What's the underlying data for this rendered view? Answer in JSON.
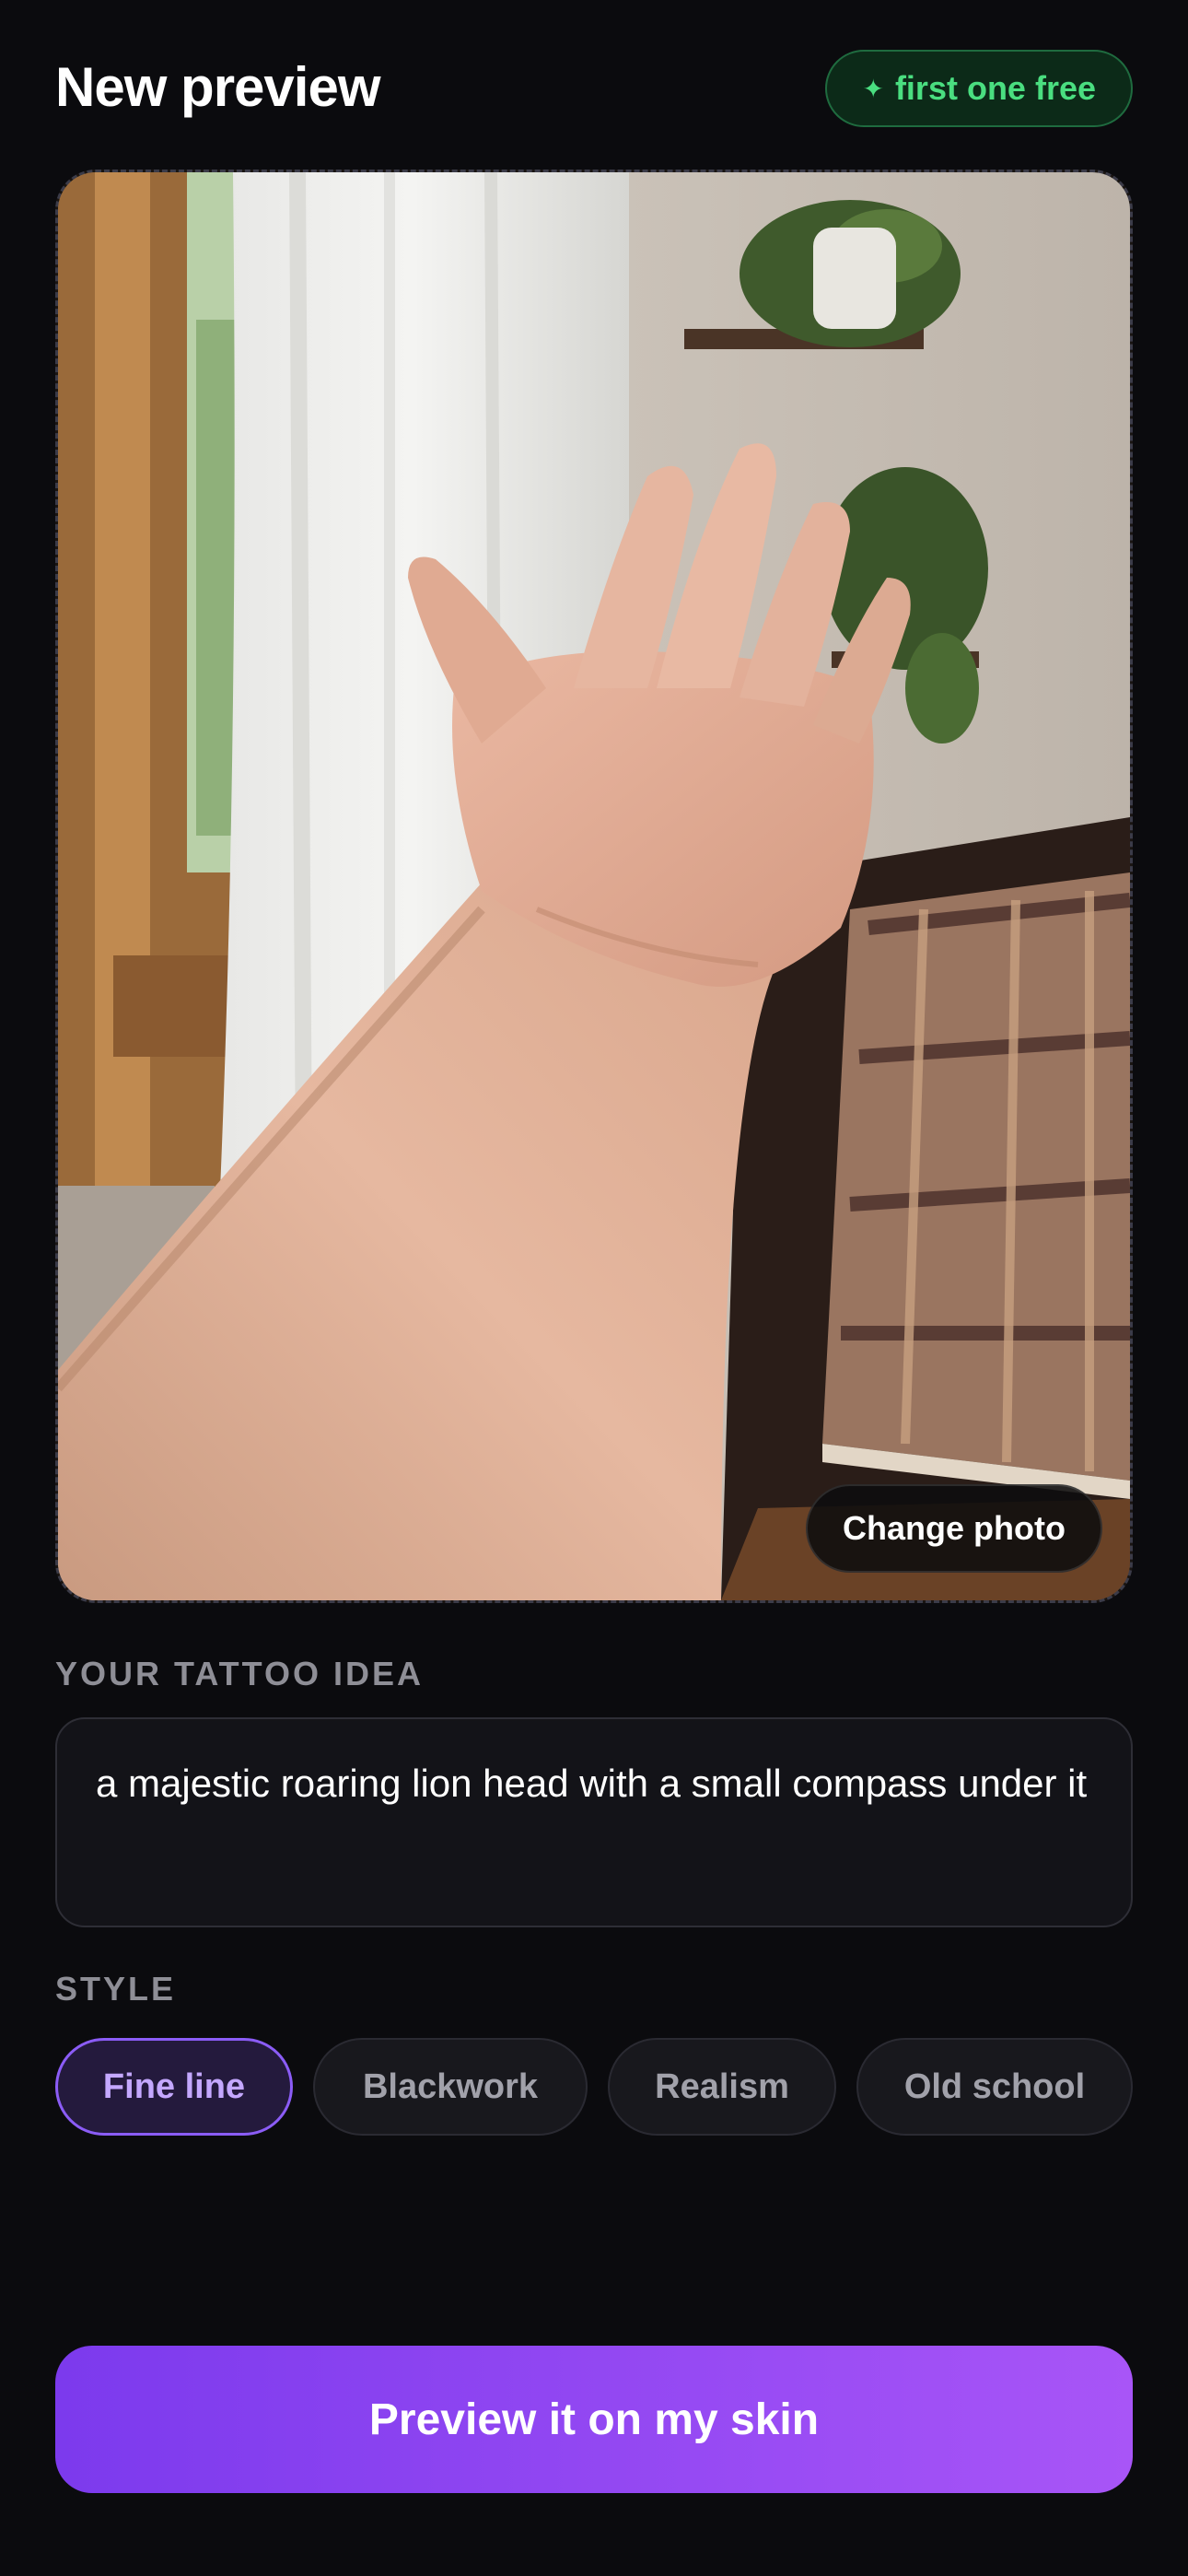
{
  "header": {
    "title": "New preview",
    "badge_icon": "sparkle-icon",
    "badge_label": "first one free",
    "badge_color": "#4ade80"
  },
  "photo": {
    "change_label": "Change photo"
  },
  "idea": {
    "label": "YOUR TATTOO IDEA",
    "value": "a majestic roaring lion head with a small compass under it"
  },
  "style": {
    "label": "STYLE",
    "options": [
      {
        "label": "Fine line",
        "selected": true
      },
      {
        "label": "Blackwork",
        "selected": false
      },
      {
        "label": "Realism",
        "selected": false
      },
      {
        "label": "Old school",
        "selected": false
      }
    ]
  },
  "cta": {
    "label": "Preview it on my skin"
  },
  "colors": {
    "accent": "#8b5cf6",
    "cta_gradient_start": "#7c3aed",
    "cta_gradient_end": "#a855f7",
    "background": "#0b0b0e"
  }
}
